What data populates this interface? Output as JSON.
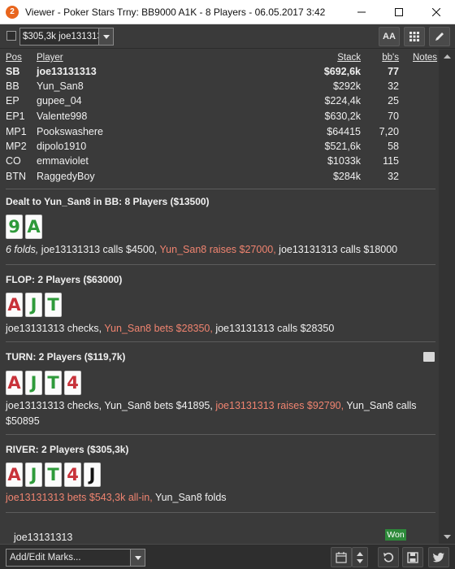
{
  "window": {
    "title": "Viewer - Poker Stars Trny: BB9000 A1K - 8 Players - 06.05.2017 3:42",
    "logo_text": "2"
  },
  "toolbar": {
    "hand_selected": "$305,3k joe131313",
    "font_button_label": "AA"
  },
  "players_header": {
    "pos": "Pos",
    "player": "Player",
    "stack": "Stack",
    "bbs": "bb's",
    "notes": "Notes"
  },
  "players": [
    {
      "pos": "SB",
      "name": "joe13131313",
      "stack": "$692,6k",
      "bbs": "77",
      "bold": true
    },
    {
      "pos": "BB",
      "name": "Yun_San8",
      "stack": "$292k",
      "bbs": "32",
      "bold": false
    },
    {
      "pos": "EP",
      "name": "gupee_04",
      "stack": "$224,4k",
      "bbs": "25",
      "bold": false
    },
    {
      "pos": "EP1",
      "name": "Valente998",
      "stack": "$630,2k",
      "bbs": "70",
      "bold": false
    },
    {
      "pos": "MP1",
      "name": "Pookswashere",
      "stack": "$64415",
      "bbs": "7,20",
      "bold": false
    },
    {
      "pos": "MP2",
      "name": "dipolo1910",
      "stack": "$521,6k",
      "bbs": "58",
      "bold": false
    },
    {
      "pos": "CO",
      "name": "emmaviolet",
      "stack": "$1033k",
      "bbs": "115",
      "bold": false
    },
    {
      "pos": "BTN",
      "name": "RaggedyBoy",
      "stack": "$284k",
      "bbs": "32",
      "bold": false
    }
  ],
  "streets": {
    "preflop": {
      "title": "Dealt to Yun_San8 in BB: 8 Players ($13500)",
      "cards": [
        {
          "rank": "9",
          "suit": "clubs",
          "color": "#2e9a3a"
        },
        {
          "rank": "A",
          "suit": "clubs",
          "color": "#2e9a3a"
        }
      ],
      "actions": {
        "a1": "6 folds,",
        "a2": " joe13131313 calls $4500,",
        "a3": " Yun_San8 raises $27000,",
        "a4": " joe13131313 calls $18000"
      }
    },
    "flop": {
      "title": "FLOP: 2 Players ($63000)",
      "cards": [
        {
          "rank": "A",
          "suit": "hearts",
          "color": "#c8323a"
        },
        {
          "rank": "J",
          "suit": "clubs",
          "color": "#2e9a3a"
        },
        {
          "rank": "T",
          "suit": "clubs",
          "color": "#2e9a3a"
        }
      ],
      "actions": {
        "a1": "joe13131313 checks,",
        "a2": " Yun_San8 bets $28350,",
        "a3": " joe13131313 calls $28350"
      }
    },
    "turn": {
      "title": "TURN: 2 Players ($119,7k)",
      "cards": [
        {
          "rank": "A",
          "suit": "hearts",
          "color": "#c8323a"
        },
        {
          "rank": "J",
          "suit": "clubs",
          "color": "#2e9a3a"
        },
        {
          "rank": "T",
          "suit": "clubs",
          "color": "#2e9a3a"
        },
        {
          "rank": "4",
          "suit": "hearts",
          "color": "#c8323a"
        }
      ],
      "actions": {
        "a1": "joe13131313 checks, Yun_San8 bets $41895,",
        "a2": " joe13131313 raises $92790,",
        "a3": " Yun_San8 calls $50895"
      }
    },
    "river": {
      "title": "RIVER: 2 Players ($305,3k)",
      "cards": [
        {
          "rank": "A",
          "suit": "hearts",
          "color": "#c8323a"
        },
        {
          "rank": "J",
          "suit": "clubs",
          "color": "#2e9a3a"
        },
        {
          "rank": "T",
          "suit": "clubs",
          "color": "#2e9a3a"
        },
        {
          "rank": "4",
          "suit": "hearts",
          "color": "#c8323a"
        },
        {
          "rank": "J",
          "suit": "spades",
          "color": "#111111"
        }
      ],
      "actions": {
        "a1": "joe13131313 bets $543,3k all-in,",
        "a2": " Yun_San8 folds"
      }
    }
  },
  "summary": {
    "player": "joe13131313",
    "result": "Won"
  },
  "bottom": {
    "marks_placeholder": "Add/Edit Marks..."
  },
  "colors": {
    "background": "#3a3a3a",
    "highlight_action": "#f08470",
    "won_badge": "#2d8a3a"
  }
}
